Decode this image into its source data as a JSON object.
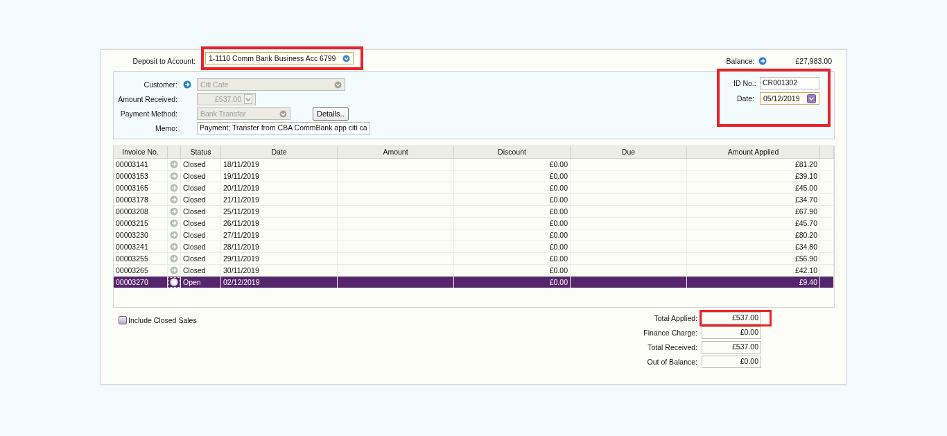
{
  "deposit": {
    "label": "Deposit to Account:",
    "value": "1-1110 Comm Bank Business Acc 6799",
    "highlighted": true
  },
  "balance": {
    "label": "Balance:",
    "value": "£27,983.00"
  },
  "customer": {
    "label": "Customer:",
    "value": "Citi Cafe",
    "disabled": true
  },
  "amount_received": {
    "label": "Amount Received:",
    "value": "£537.00",
    "disabled": true
  },
  "payment_method": {
    "label": "Payment Method:",
    "value": "Bank Transfer",
    "disabled": true
  },
  "details_button": "Details..",
  "memo": {
    "label": "Memo:",
    "value": "Payment; Transfer from CBA CommBank app citi ca"
  },
  "id_date": {
    "highlighted": true,
    "id_label": "ID No.:",
    "id_value": "CR001302",
    "date_label": "Date:",
    "date_value": "05/12/2019"
  },
  "table": {
    "columns": [
      "Invoice No.",
      "Status",
      "Date",
      "Amount",
      "Discount",
      "Due",
      "Amount Applied"
    ],
    "rows": [
      {
        "invoice": "00003141",
        "status": "Closed",
        "date": "18/11/2019",
        "discount": "£0.00",
        "applied": "£81.20",
        "selected": false
      },
      {
        "invoice": "00003153",
        "status": "Closed",
        "date": "19/11/2019",
        "discount": "£0.00",
        "applied": "£39.10",
        "selected": false
      },
      {
        "invoice": "00003165",
        "status": "Closed",
        "date": "20/11/2019",
        "discount": "£0.00",
        "applied": "£45.00",
        "selected": false
      },
      {
        "invoice": "00003178",
        "status": "Closed",
        "date": "21/11/2019",
        "discount": "£0.00",
        "applied": "£34.70",
        "selected": false
      },
      {
        "invoice": "00003208",
        "status": "Closed",
        "date": "25/11/2019",
        "discount": "£0.00",
        "applied": "£67.90",
        "selected": false
      },
      {
        "invoice": "00003215",
        "status": "Closed",
        "date": "26/11/2019",
        "discount": "£0.00",
        "applied": "£45.70",
        "selected": false
      },
      {
        "invoice": "00003230",
        "status": "Closed",
        "date": "27/11/2019",
        "discount": "£0.00",
        "applied": "£80.20",
        "selected": false
      },
      {
        "invoice": "00003241",
        "status": "Closed",
        "date": "28/11/2019",
        "discount": "£0.00",
        "applied": "£34.80",
        "selected": false
      },
      {
        "invoice": "00003255",
        "status": "Closed",
        "date": "29/11/2019",
        "discount": "£0.00",
        "applied": "£56.90",
        "selected": false
      },
      {
        "invoice": "00003265",
        "status": "Closed",
        "date": "30/11/2019",
        "discount": "£0.00",
        "applied": "£42.10",
        "selected": false
      },
      {
        "invoice": "00003270",
        "status": "Open",
        "date": "02/12/2019",
        "discount": "£0.00",
        "applied": "£9.40",
        "selected": true
      }
    ]
  },
  "include_closed": {
    "label": "Include Closed Sales",
    "checked": false
  },
  "totals": [
    {
      "label": "Total Applied:",
      "value": "£537.00",
      "highlighted": true
    },
    {
      "label": "Finance Charge:",
      "value": "£0.00",
      "highlighted": false
    },
    {
      "label": "Total Received:",
      "value": "£537.00",
      "highlighted": false
    },
    {
      "label": "Out of Balance:",
      "value": "£0.00",
      "highlighted": false
    }
  ]
}
